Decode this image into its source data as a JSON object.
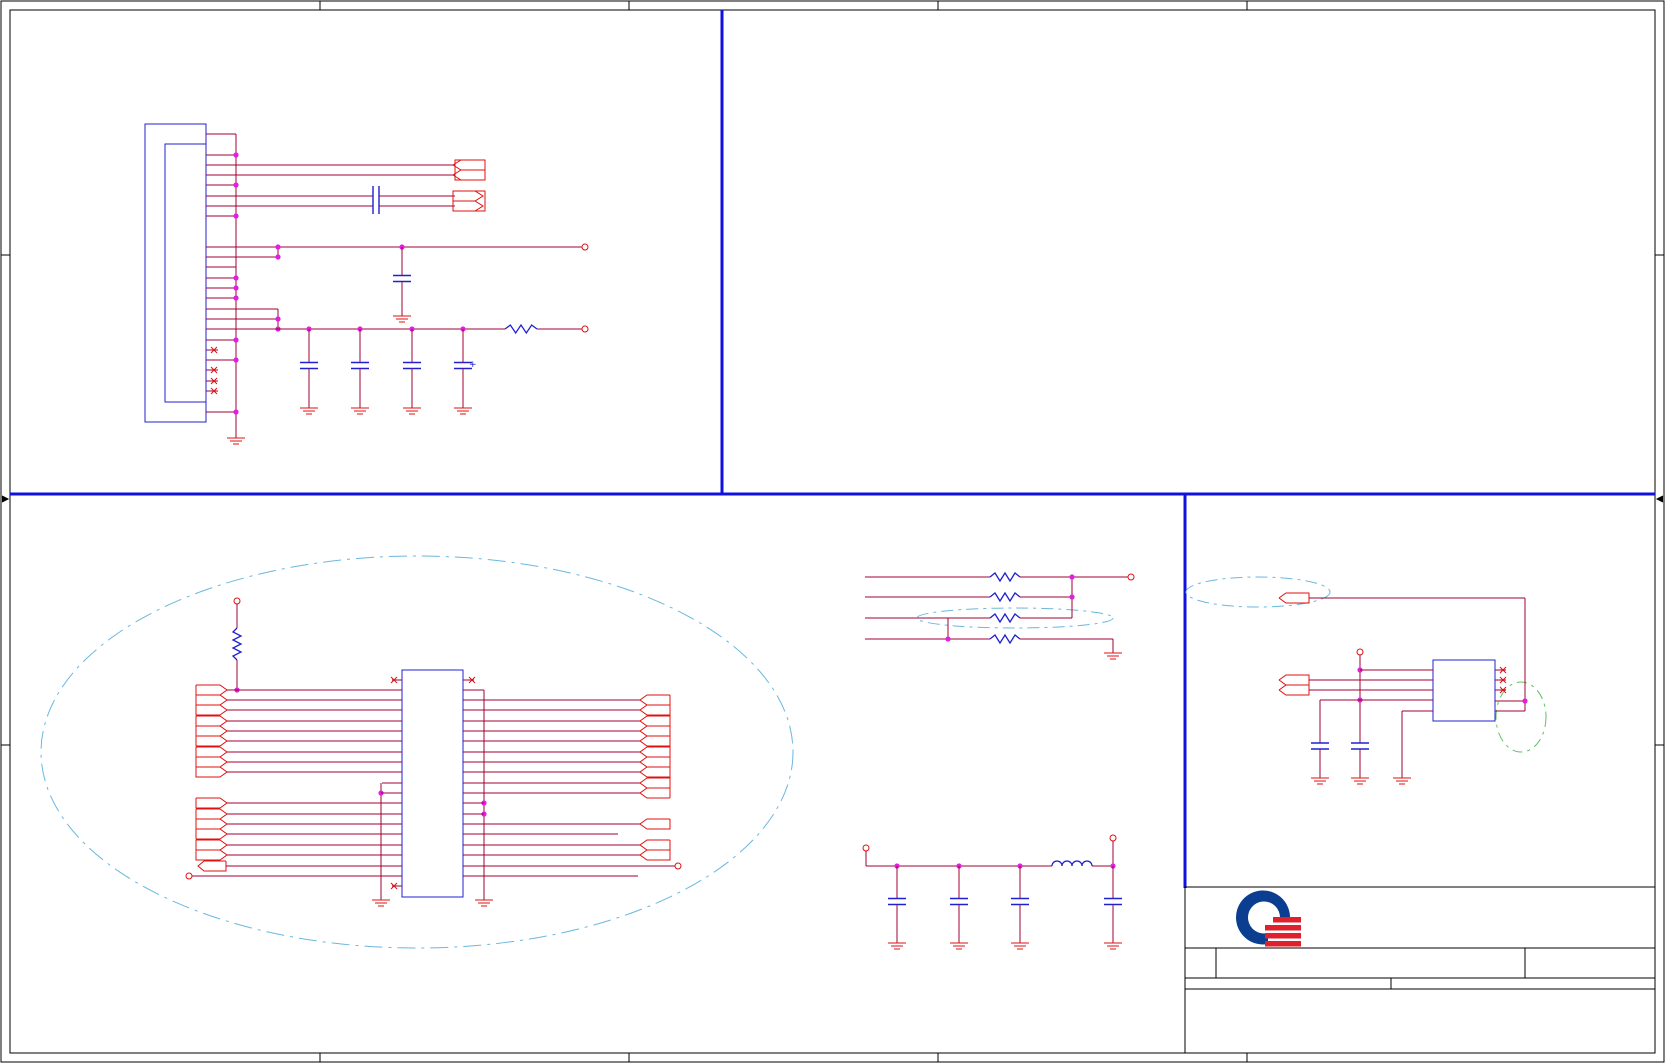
{
  "sheet": {
    "background": "#ffffff",
    "colors": {
      "frame": "#000000",
      "border": "#1010e0",
      "wire": "#a00030",
      "symbol": "#e01010",
      "part": "#2020d0",
      "junction": "#e020e0",
      "group_outline": "#6ab8e0",
      "group_outline_alt": "#60c060",
      "logo_blue": "#0b3d91",
      "logo_red": "#e0202c"
    },
    "sections": [
      "connector-power",
      "blank",
      "buffer-ic",
      "resistor-network",
      "power-filter",
      "logo-ic"
    ]
  }
}
